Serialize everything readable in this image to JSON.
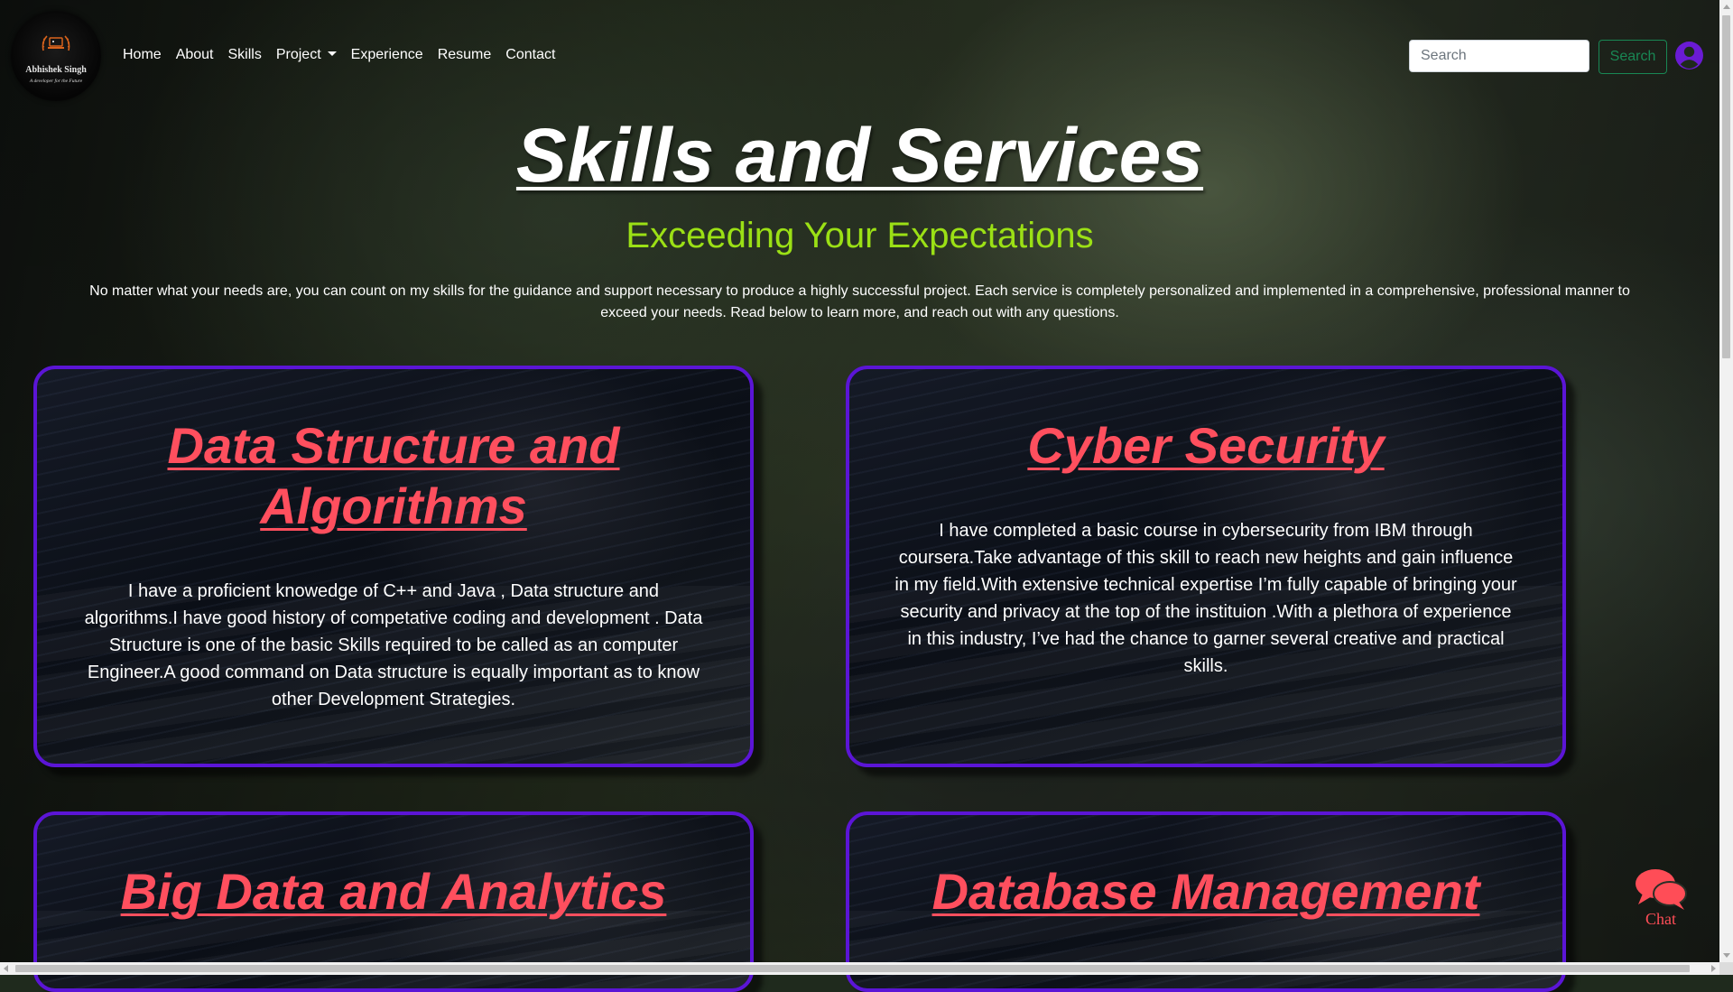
{
  "brand": {
    "name": "Abhishek Singh",
    "tagline": "A developer for the Future",
    "logo_icon": "laptop-laurel-icon"
  },
  "nav": {
    "items": [
      {
        "label": "Home"
      },
      {
        "label": "About"
      },
      {
        "label": "Skills"
      },
      {
        "label": "Project",
        "dropdown": true
      },
      {
        "label": "Experience"
      },
      {
        "label": "Resume"
      },
      {
        "label": "Contact"
      }
    ],
    "search_placeholder": "Search",
    "search_button": "Search",
    "user_icon": "user-circle-icon"
  },
  "hero": {
    "title": "Skills and Services",
    "subtitle": "Exceeding Your Expectations",
    "intro": "No matter what your needs are, you can count on my skills for the guidance and support necessary to produce a highly successful project. Each service is completely personalized and implemented in a comprehensive, professional manner to exceed your needs. Read below to learn more, and reach out with any questions."
  },
  "cards": [
    {
      "title": "Data Structure and Algorithms",
      "text": "I have a proficient knowedge of C++ and Java , Data structure and algorithms.I have good history of competative coding and development . Data Structure is one of the basic Skills required to be called as an computer Engineer.A good command on Data structure is equally important as to know other Development Strategies."
    },
    {
      "title": "Cyber Security",
      "text": "I have completed a basic course in cybersecurity from IBM through coursera.Take advantage of this skill to reach new heights and gain influence in my field.With extensive technical expertise I’m fully capable of bringing your security and privacy at the top of the instituion .With a plethora of experience in this industry, I’ve had the chance to garner several creative and practical skills."
    },
    {
      "title": "Big Data and Analytics"
    },
    {
      "title": "Database Management"
    }
  ],
  "chat": {
    "label": "Chat",
    "icon": "chat-bubbles-icon"
  },
  "colors": {
    "card_title": "#ff4f5e",
    "card_border": "#5b15d6",
    "subtitle": "#9be015",
    "search_button": "#198754",
    "user_icon": "#6a1bd4",
    "chat": "#ff4d57"
  }
}
